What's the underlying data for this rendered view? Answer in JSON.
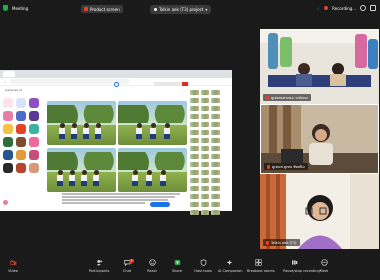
{
  "topbar": {
    "meeting_label": "Meeting",
    "share_pill": "Product screen",
    "view_label": "Talkin aek (T3) project",
    "recording_label": "Recording..."
  },
  "share": {
    "brand": "Galleries AI"
  },
  "participants": [
    {
      "name": "คูเทนทเทาเทเจ วกถ์เทเจ"
    },
    {
      "name": "คูเทนฟ คูเทน ซัทสนิม"
    },
    {
      "name": "Talkin aek (T3)"
    }
  ],
  "toolbar": {
    "items": [
      {
        "label": "Video",
        "icon": "video-icon"
      },
      {
        "label": "Participants",
        "icon": "participants-icon"
      },
      {
        "label": "Chat",
        "icon": "chat-icon",
        "badge": "1"
      },
      {
        "label": "React",
        "icon": "react-icon"
      },
      {
        "label": "Share",
        "icon": "share-icon"
      },
      {
        "label": "Host tools",
        "icon": "shield-icon"
      },
      {
        "label": "AI Companion",
        "icon": "sparkle-icon"
      },
      {
        "label": "Breakout rooms",
        "icon": "breakout-icon"
      },
      {
        "label": "Pause/stop recording",
        "icon": "record-icon"
      },
      {
        "label": "More",
        "icon": "more-icon"
      }
    ]
  },
  "colors": {
    "accent": "#1a73e8",
    "record": "#e0452a",
    "share": "#2aa84a"
  }
}
